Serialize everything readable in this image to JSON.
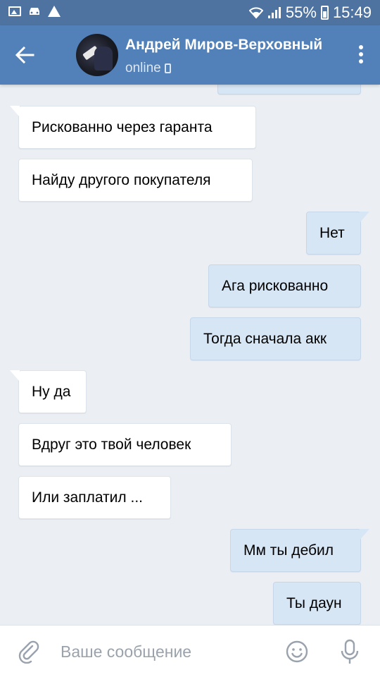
{
  "status_bar": {
    "battery_percent": "55%",
    "time": "15:49",
    "icons": [
      "image-icon",
      "car-icon",
      "warning-icon",
      "wifi-icon",
      "signal-icon",
      "battery-icon"
    ]
  },
  "header": {
    "contact_name": "Андрей Миров-Верховный",
    "status": "online",
    "status_device_icon": "phone-icon",
    "background_color": "#5181b8"
  },
  "messages": [
    {
      "direction": "out",
      "text": ""
    },
    {
      "direction": "in",
      "text": "Рискованно через гаранта"
    },
    {
      "direction": "in",
      "text": "Найду другого покупателя"
    },
    {
      "direction": "out",
      "text": "Нет"
    },
    {
      "direction": "out",
      "text": "Ага рискованно"
    },
    {
      "direction": "out",
      "text": "Тогда сначала акк"
    },
    {
      "direction": "in",
      "text": "Ну да"
    },
    {
      "direction": "in",
      "text": "Вдруг это твой человек"
    },
    {
      "direction": "in",
      "text": "Или заплатил ..."
    },
    {
      "direction": "out",
      "text": "Мм ты дебил"
    },
    {
      "direction": "out",
      "text": "Ты даун"
    }
  ],
  "input_bar": {
    "placeholder": "Ваше сообщение",
    "icons": [
      "paperclip-icon",
      "emoji-icon",
      "microphone-icon"
    ]
  },
  "colors": {
    "incoming_bubble": "#ffffff",
    "outgoing_bubble": "#d7e6f5",
    "chat_background": "#ebeff4"
  }
}
